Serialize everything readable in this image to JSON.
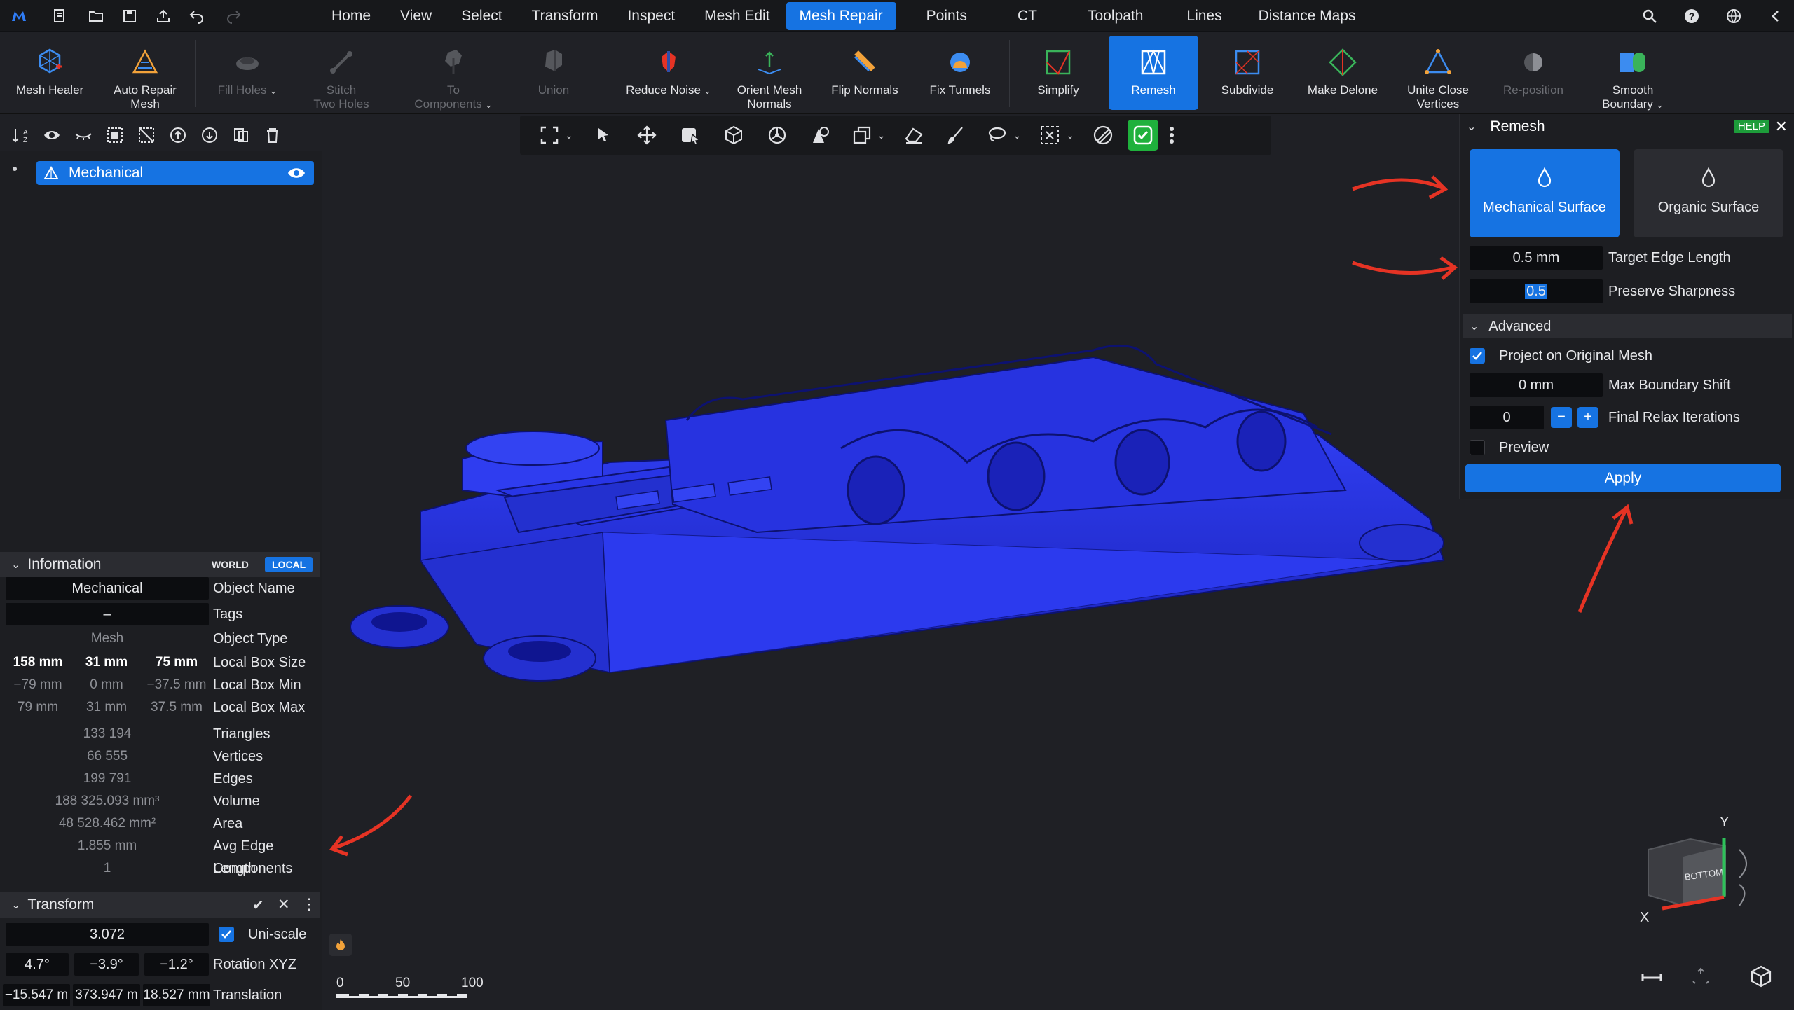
{
  "menu": {
    "items": [
      "Home",
      "View",
      "Select",
      "Transform",
      "Inspect",
      "Mesh Edit",
      "Mesh Repair",
      "Points",
      "CT",
      "Toolpath",
      "Lines",
      "Distance Maps"
    ],
    "active": "Mesh Repair"
  },
  "ribbon": {
    "mesh_healer": "Mesh Healer",
    "auto_repair": "Auto Repair\nMesh",
    "fill_holes": "Fill Holes",
    "stitch": "Stitch\nTwo Holes",
    "to_components": "To\nComponents",
    "union": "Union",
    "reduce_noise": "Reduce Noise",
    "orient_normals": "Orient Mesh\nNormals",
    "flip_normals": "Flip Normals",
    "fix_tunnels": "Fix Tunnels",
    "simplify": "Simplify",
    "remesh": "Remesh",
    "subdivide": "Subdivide",
    "make_delone": "Make Delone",
    "unite_close": "Unite Close\nVertices",
    "reposition": "Re-position",
    "smooth_boundary": "Smooth\nBoundary"
  },
  "tree": {
    "item": "Mechanical"
  },
  "info": {
    "title": "Information",
    "world": "WORLD",
    "local": "LOCAL",
    "object_name": "Mechanical",
    "object_name_lbl": "Object Name",
    "tags": "–",
    "tags_lbl": "Tags",
    "type": "Mesh",
    "type_lbl": "Object Type",
    "box_size": [
      "158 mm",
      "31 mm",
      "75 mm"
    ],
    "box_size_lbl": "Local Box Size",
    "box_min": [
      "−79 mm",
      "0 mm",
      "−37.5 mm"
    ],
    "box_min_lbl": "Local Box Min",
    "box_max": [
      "79 mm",
      "31 mm",
      "37.5 mm"
    ],
    "box_max_lbl": "Local Box Max",
    "triangles": "133 194",
    "triangles_lbl": "Triangles",
    "vertices": "66 555",
    "vertices_lbl": "Vertices",
    "edges": "199 791",
    "edges_lbl": "Edges",
    "volume": "188 325.093 mm³",
    "volume_lbl": "Volume",
    "area": "48 528.462 mm²",
    "area_lbl": "Area",
    "avg_edge": "1.855 mm",
    "avg_edge_lbl": "Avg Edge Length",
    "components": "1",
    "components_lbl": "Components"
  },
  "transform": {
    "title": "Transform",
    "scale": "3.072",
    "uniscale_lbl": "Uni-scale",
    "rotation": [
      "4.7°",
      "−3.9°",
      "−1.2°"
    ],
    "rotation_lbl": "Rotation XYZ",
    "translation": [
      "−15.547 m",
      "373.947 m",
      "18.527 mm"
    ],
    "translation_lbl": "Translation"
  },
  "remesh": {
    "title": "Remesh",
    "help": "HELP",
    "mode_mech": "Mechanical Surface",
    "mode_org": "Organic Surface",
    "target_edge": "0.5 mm",
    "target_edge_lbl": "Target Edge Length",
    "sharpness": "0.5",
    "sharpness_lbl": "Preserve Sharpness",
    "advanced": "Advanced",
    "project_lbl": "Project on Original Mesh",
    "max_shift": "0 mm",
    "max_shift_lbl": "Max Boundary Shift",
    "relax": "0",
    "relax_lbl": "Final Relax Iterations",
    "preview_lbl": "Preview",
    "apply": "Apply"
  },
  "scale_bar": {
    "ticks": [
      "0",
      "50",
      "100"
    ]
  },
  "viewcube": {
    "face": "BOTTOM",
    "y": "Y",
    "x": "X"
  },
  "colors": {
    "accent": "#1673e2",
    "mesh": "#2230d8",
    "annotation": "#e53324"
  }
}
